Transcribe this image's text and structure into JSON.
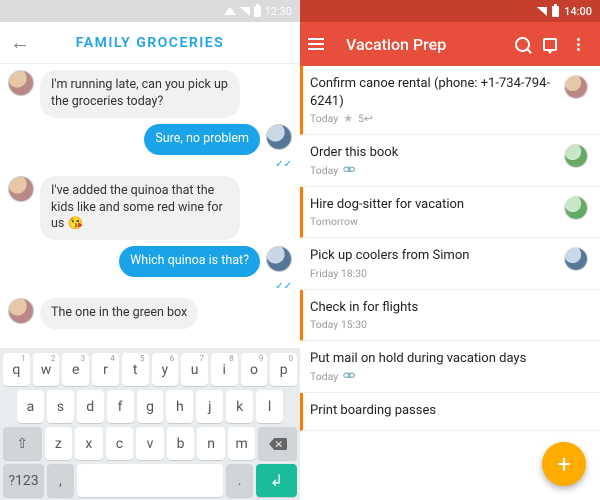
{
  "left": {
    "status_time": "12:30",
    "title": "FAMILY GROCERIES",
    "messages": [
      {
        "dir": "in",
        "text": "I'm running late, can you pick up the groceries today?"
      },
      {
        "dir": "out",
        "text": "Sure, no problem"
      },
      {
        "dir": "in",
        "text": "I've added the quinoa that the kids like and some red wine for us 😘"
      },
      {
        "dir": "out",
        "text": "Which quinoa is that?"
      },
      {
        "dir": "in",
        "text": "The one in the green box"
      }
    ],
    "keyboard": {
      "row1": [
        {
          "k": "q",
          "n": "1"
        },
        {
          "k": "w",
          "n": "2"
        },
        {
          "k": "e",
          "n": "3"
        },
        {
          "k": "r",
          "n": "4"
        },
        {
          "k": "t",
          "n": "5"
        },
        {
          "k": "y",
          "n": "6"
        },
        {
          "k": "u",
          "n": "7"
        },
        {
          "k": "i",
          "n": "8"
        },
        {
          "k": "o",
          "n": "9"
        },
        {
          "k": "p",
          "n": "0"
        }
      ],
      "row2": [
        "a",
        "s",
        "d",
        "f",
        "g",
        "h",
        "j",
        "k",
        "l"
      ],
      "row3": [
        "z",
        "x",
        "c",
        "v",
        "b",
        "n",
        "m"
      ],
      "shift": "⇧",
      "symkey": "?123",
      "comma": ",",
      "period": ".",
      "return": "↲"
    }
  },
  "right": {
    "status_time": "14:00",
    "title": "Vacation Prep",
    "tasks": [
      {
        "title": "Confirm canoe rental (phone: +1-734-794-6241)",
        "meta": "Today",
        "star": true,
        "count": "5",
        "marked": true,
        "av": "a"
      },
      {
        "title": "Order this book",
        "meta": "Today",
        "clip": true,
        "marked": false,
        "av": "b"
      },
      {
        "title": "Hire dog-sitter for vacation",
        "meta": "Tomorrow",
        "marked": true,
        "av": "b"
      },
      {
        "title": "Pick up coolers from Simon",
        "meta": "Friday 18:30",
        "marked": false,
        "av": "c"
      },
      {
        "title": "Check in for flights",
        "meta": "Today 15:30",
        "marked": true,
        "av": ""
      },
      {
        "title": "Put mail on hold during vacation days",
        "meta": "Today",
        "clip": true,
        "marked": false,
        "av": ""
      },
      {
        "title": "Print boarding passes",
        "meta": "",
        "marked": true,
        "av": ""
      }
    ],
    "fab": "+"
  }
}
